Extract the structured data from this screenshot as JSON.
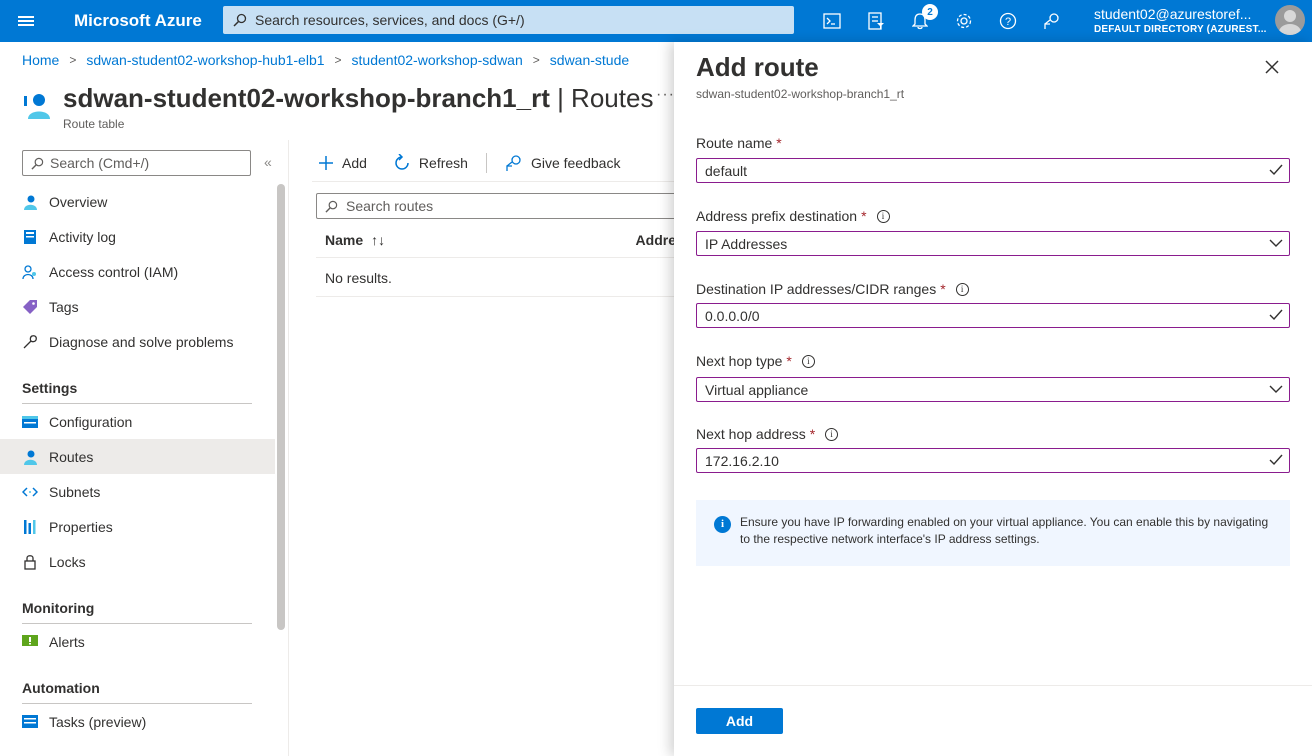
{
  "topbar": {
    "brand": "Microsoft Azure",
    "search_placeholder": "Search resources, services, and docs (G+/)",
    "notification_count": "2",
    "account_name": "student02@azurestoref...",
    "account_directory": "DEFAULT DIRECTORY (AZUREST..."
  },
  "breadcrumb": {
    "items": [
      "Home",
      "sdwan-student02-workshop-hub1-elb1",
      "student02-workshop-sdwan",
      "sdwan-stude"
    ]
  },
  "page": {
    "resource_name": "sdwan-student02-workshop-branch1_rt",
    "section": " | Routes",
    "subtitle": "Route table",
    "more": "···"
  },
  "sidebar": {
    "search_placeholder": "Search (Cmd+/)",
    "collapse": "«",
    "items": [
      {
        "label": "Overview",
        "icon": "overview-icon"
      },
      {
        "label": "Activity log",
        "icon": "activity-log-icon"
      },
      {
        "label": "Access control (IAM)",
        "icon": "iam-icon"
      },
      {
        "label": "Tags",
        "icon": "tag-icon"
      },
      {
        "label": "Diagnose and solve problems",
        "icon": "wrench-icon"
      }
    ],
    "sections": [
      {
        "title": "Settings",
        "items": [
          {
            "label": "Configuration",
            "icon": "configuration-icon"
          },
          {
            "label": "Routes",
            "icon": "routes-icon",
            "active": true
          },
          {
            "label": "Subnets",
            "icon": "subnets-icon"
          },
          {
            "label": "Properties",
            "icon": "properties-icon"
          },
          {
            "label": "Locks",
            "icon": "lock-icon"
          }
        ]
      },
      {
        "title": "Monitoring",
        "items": [
          {
            "label": "Alerts",
            "icon": "alert-icon"
          }
        ]
      },
      {
        "title": "Automation",
        "items": [
          {
            "label": "Tasks (preview)",
            "icon": "tasks-icon"
          }
        ]
      }
    ]
  },
  "toolbar": {
    "add_label": "Add",
    "refresh_label": "Refresh",
    "feedback_label": "Give feedback"
  },
  "routes": {
    "search_placeholder": "Search routes",
    "col_name": "Name",
    "col_address": "Addre",
    "sort_glyph": "↑↓",
    "empty_text": "No results."
  },
  "panel": {
    "title": "Add route",
    "subtitle": "sdwan-student02-workshop-branch1_rt",
    "route_name_label": "Route name",
    "route_name_value": "default",
    "prefix_label": "Address prefix destination",
    "prefix_value": "IP Addresses",
    "cidr_label": "Destination IP addresses/CIDR ranges",
    "cidr_value": "0.0.0.0/0",
    "hop_type_label": "Next hop type",
    "hop_type_value": "Virtual appliance",
    "hop_address_label": "Next hop address",
    "hop_address_value": "172.16.2.10",
    "required_mark": "*",
    "info_text": "Ensure you have IP forwarding enabled on your virtual appliance. You can enable this by navigating to the respective network interface's IP address settings.",
    "add_button": "Add"
  },
  "colors": {
    "accent": "#0078d4",
    "field_border": "#8a1c8e",
    "required": "#a4262c"
  }
}
